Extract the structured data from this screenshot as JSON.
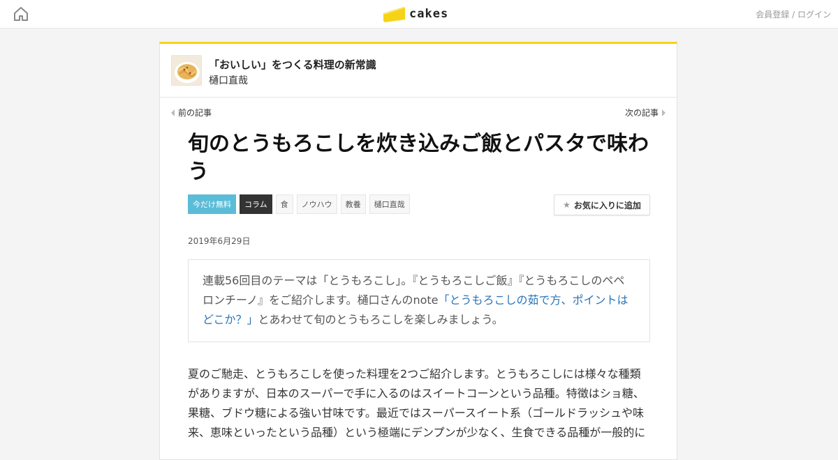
{
  "header": {
    "logo_text": "cakes",
    "auth_register": "会員登録",
    "auth_separator": " / ",
    "auth_login": "ログイン",
    "brand_color": "#f6d316"
  },
  "series": {
    "title": "「おいしい」をつくる料理の新常識",
    "author": "樋口直哉"
  },
  "nav": {
    "prev": "前の記事",
    "next": "次の記事"
  },
  "article": {
    "title": "旬のとうもろこしを炊き込みご飯とパスタで味わう",
    "tags": [
      "今だけ無料",
      "コラム",
      "食",
      "ノウハウ",
      "教養",
      "樋口直哉"
    ],
    "favorite_label": "お気に入りに追加",
    "date": "2019年6月29日",
    "lead_before": "連載56回目のテーマは「とうもろこし」。『とうもろこしご飯』『とうもろこしのペペロンチーノ』をご紹介します。樋口さんのnote",
    "lead_link": "「とうもろこしの茹で方、ポイントはどこか？」",
    "lead_after": "とあわせて旬のとうもろこしを楽しみましょう。",
    "body": "夏のご馳走、とうもろこしを使った料理を2つご紹介します。とうもろこしには様々な種類がありますが、日本のスーパーで手に入るのはスイートコーンという品種。特徴はショ糖、果糖、ブドウ糖による強い甘味です。最近ではスーパースイート系（ゴールドラッシュや味来、恵味といったという品種）という極端にデンプンが少なく、生食できる品種が一般的に"
  },
  "colors": {
    "free_tag": "#5bbcd8",
    "column_tag": "#333333",
    "link": "#2a74b9"
  }
}
